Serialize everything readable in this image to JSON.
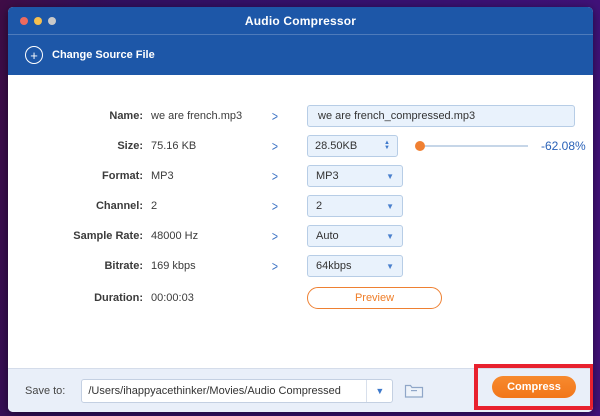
{
  "window": {
    "title": "Audio Compressor"
  },
  "header": {
    "change_source_label": "Change Source File",
    "plus_icon": "+"
  },
  "icons": {
    "chevron": ">",
    "dropdown_arrow": "▼",
    "stepper_up": "▲",
    "stepper_down": "▼"
  },
  "form": {
    "rows": [
      {
        "label": "Name:",
        "value": "we are french.mp3",
        "control": {
          "type": "text",
          "value": "we are french_compressed.mp3"
        }
      },
      {
        "label": "Size:",
        "value": "75.16 KB",
        "control": {
          "type": "stepper",
          "value": "28.50KB"
        },
        "percent": "-62.08%"
      },
      {
        "label": "Format:",
        "value": "MP3",
        "control": {
          "type": "select",
          "value": "MP3"
        }
      },
      {
        "label": "Channel:",
        "value": "2",
        "control": {
          "type": "select",
          "value": "2"
        }
      },
      {
        "label": "Sample Rate:",
        "value": "48000 Hz",
        "control": {
          "type": "select",
          "value": "Auto"
        }
      },
      {
        "label": "Bitrate:",
        "value": "169 kbps",
        "control": {
          "type": "select",
          "value": "64kbps"
        }
      },
      {
        "label": "Duration:",
        "value": "00:00:03",
        "control": {
          "type": "button",
          "value": "Preview"
        }
      }
    ]
  },
  "footer": {
    "save_to_label": "Save to:",
    "save_path": "/Users/ihappyacethinker/Movies/Audio Compressed",
    "compress_label": "Compress"
  },
  "colors": {
    "titlebar_blue": "#1d57a8",
    "accent_orange": "#f2761a",
    "annotation_red": "#e8212e",
    "percent_blue": "#2a62b8"
  }
}
